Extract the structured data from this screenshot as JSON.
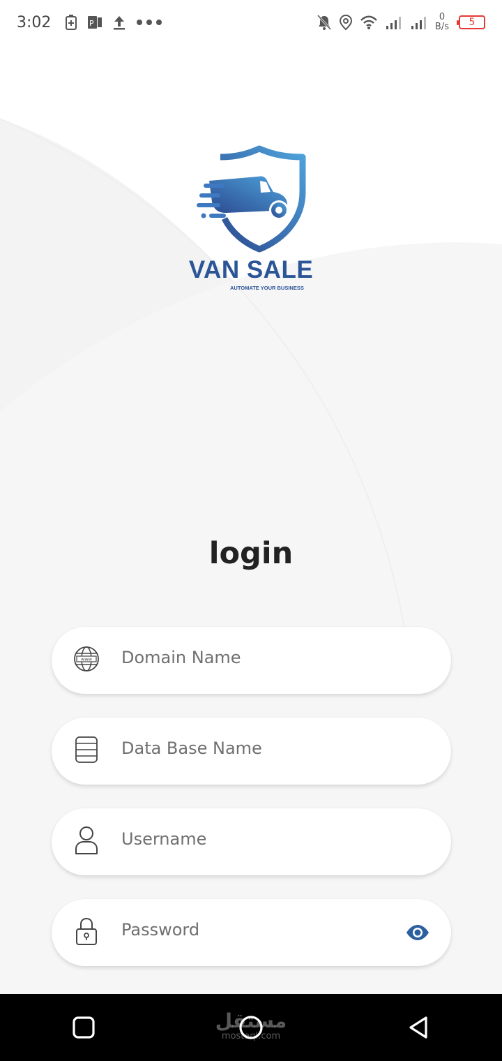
{
  "status_bar": {
    "time": "3:02",
    "left_icons": [
      "battery-saver-icon",
      "app-notification-icon",
      "upload-icon",
      "more-dots-icon"
    ],
    "right_icons": [
      "notifications-off-icon",
      "location-icon",
      "wifi-icon",
      "signal-icon",
      "signal-icon-2"
    ],
    "net_speed_value": "0",
    "net_speed_unit": "B/s",
    "battery_level": "5",
    "battery_color": "#e53935"
  },
  "logo": {
    "title": "VAN SALE",
    "tagline": "AUTOMATE YOUR BUSINESS",
    "brand_color": "#2b5597"
  },
  "login": {
    "title": "login",
    "fields": {
      "domain": {
        "placeholder": "Domain Name",
        "value": "",
        "icon": "globe-www-icon"
      },
      "database": {
        "placeholder": "Data Base Name",
        "value": "",
        "icon": "database-icon"
      },
      "username": {
        "placeholder": "Username",
        "value": "",
        "icon": "user-icon"
      },
      "password": {
        "placeholder": "Password",
        "value": "",
        "icon": "lock-icon",
        "toggle_icon": "eye-icon"
      }
    },
    "accent_color": "#2b5fa0"
  },
  "nav_bar": {
    "buttons": [
      "recent-apps-icon",
      "home-icon",
      "back-icon"
    ]
  },
  "watermark": {
    "arabic": "مستقل",
    "latin": "mostaql.com"
  }
}
